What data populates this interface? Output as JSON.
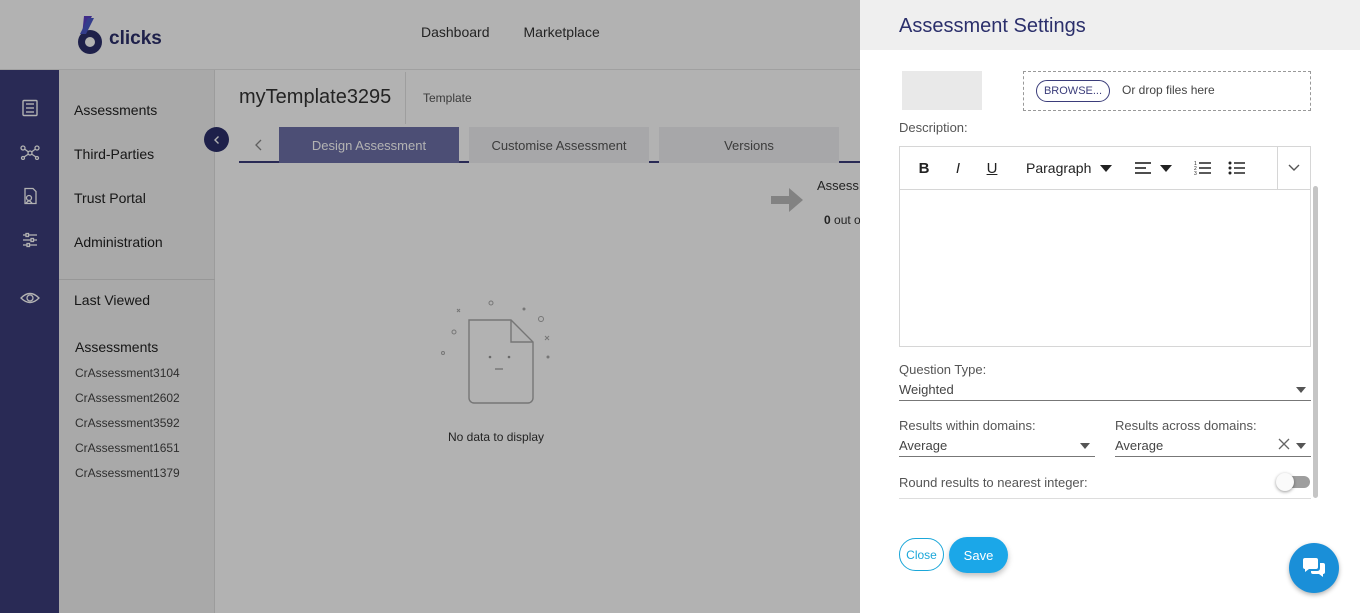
{
  "header": {
    "logo_text": "clicks",
    "logo_glyph": "6",
    "nav": [
      "Dashboard",
      "Marketplace"
    ]
  },
  "rail": {
    "icons": [
      "assessments-icon",
      "third-parties-icon",
      "trust-portal-icon",
      "administration-icon",
      "last-viewed-icon"
    ]
  },
  "sidemenu": {
    "items": [
      "Assessments",
      "Third-Parties",
      "Trust Portal",
      "Administration"
    ],
    "last_viewed": "Last Viewed",
    "recent_heading": "Assessments",
    "recent": [
      "CrAssessment3104",
      "CrAssessment2602",
      "CrAssessment3592",
      "CrAssessment1651",
      "CrAssessment1379"
    ]
  },
  "main": {
    "title": "myTemplate3295",
    "subtitle": "Template",
    "tabs": [
      "Design Assessment",
      "Customise Assessment",
      "Versions"
    ],
    "active_tab": 0,
    "assess_label": "Assess",
    "assess_count_bold": "0",
    "assess_count_text": " out o",
    "empty_text": "No data to display"
  },
  "panel": {
    "title": "Assessment Settings",
    "browse_label": "BROWSE...",
    "drop_text": "Or drop files here",
    "description_label": "Description:",
    "editor": {
      "paragraph_label": "Paragraph",
      "bold": "B",
      "italic": "I",
      "underline": "U"
    },
    "question_type_label": "Question Type:",
    "question_type_value": "Weighted",
    "within_label": "Results within domains:",
    "within_value": "Average",
    "across_label": "Results across domains:",
    "across_value": "Average",
    "round_label": "Round results to nearest integer:",
    "round_enabled": false,
    "close_label": "Close",
    "save_label": "Save"
  },
  "colors": {
    "brand": "#2b2f6b",
    "rail": "#3b3d7a",
    "accent": "#1ba7e8"
  }
}
